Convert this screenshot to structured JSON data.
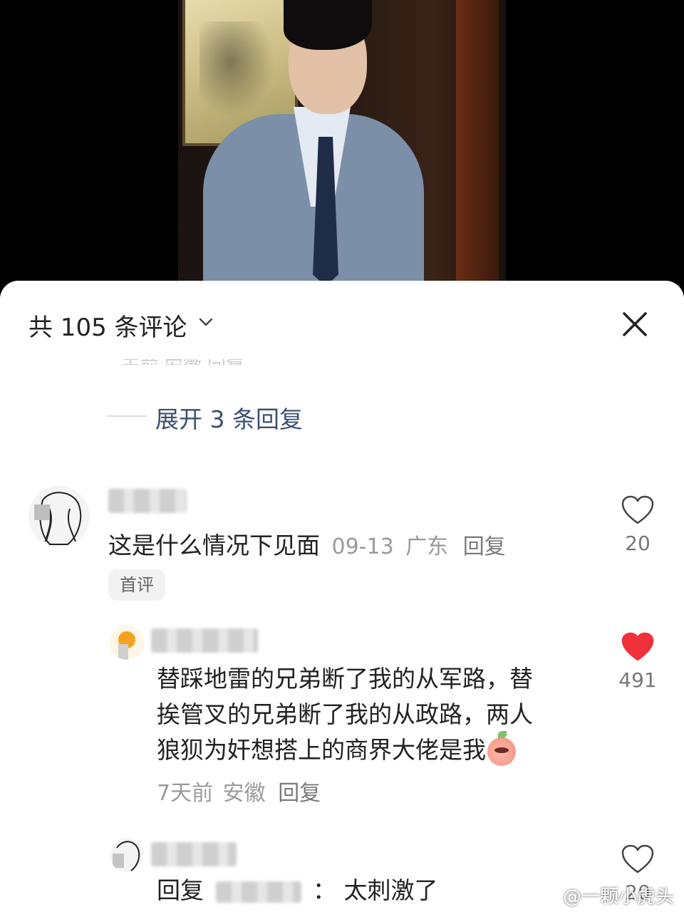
{
  "header": {
    "title": "共 105 条评论",
    "close_icon": "close-icon",
    "chevron_icon": "chevron-down-icon"
  },
  "faded_above": "· 天前 安徽 回复",
  "expand_replies": "展开 3 条回复",
  "comments": [
    {
      "text": "这是什么情况下见面",
      "date": "09-13",
      "location": "广东",
      "reply_label": "回复",
      "tag": "首评",
      "likes": "20",
      "liked": false
    }
  ],
  "replies": [
    {
      "text_lines": [
        "替踩地雷的兄弟断了我的从军路，替",
        "挨管叉的兄弟断了我的从政路，两人",
        "狼狈为奸想搭上的商界大佬是我"
      ],
      "emoji": "peach-emoji",
      "time": "7天前",
      "location": "安徽",
      "reply_label": "回复",
      "likes": "491",
      "liked": true,
      "like_color": "#f0303a"
    },
    {
      "prefix": "回复",
      "text": "太刺激了",
      "likes": "20",
      "liked": false
    }
  ],
  "watermark": "@一颗小虎头"
}
